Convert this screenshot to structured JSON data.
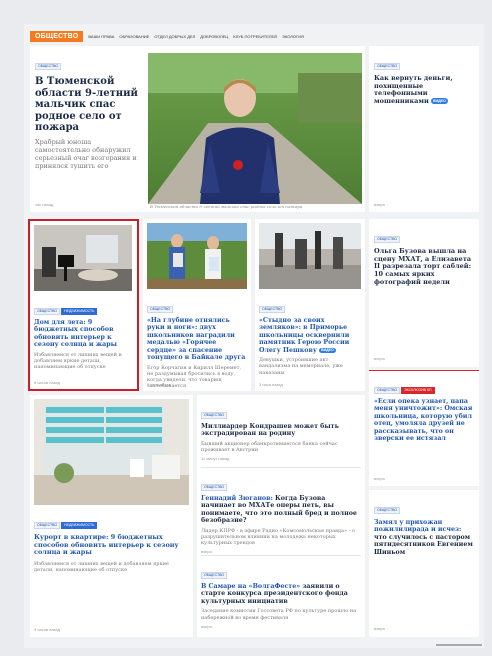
{
  "section_tag": "ОБЩЕСТВО",
  "nav": [
    "ВАШИ ПРАВА",
    "ОБРАЗОВАНИЕ",
    "ОТДЕЛ ДОБРЫХ ДЕЛ",
    "ДОБРОВОЛЕЦ",
    "КЛУБ ПОТРЕБИТЕЛЕЙ",
    "ЭКОЛОГИЯ"
  ],
  "hero": {
    "badge": "ОБЩЕСТВО",
    "title": "В Тюменской области 9-летний мальчик спас родное село от пожара",
    "lead": "Храбрый юноша самостоятельно обнаружил серьезный очаг возгорания и принялся тушить его",
    "meta": "час назад",
    "caption": "В Тюменской области 9-летний мальчик спас родное село от пожара."
  },
  "side1": {
    "badge": "ОБЩЕСТВО",
    "title": "Как вернуть деньги, похищенные телефонными мошенниками",
    "video": "ВИДЕО",
    "meta": "вчера"
  },
  "card_a": {
    "badges": [
      "ОБЩЕСТВО",
      "НЕДВИЖИМОСТЬ"
    ],
    "title": "Дом для лета: 9 бюджетных способов обновить интерьер к сезону солнца и жары",
    "lead": "Избавляемся от лишних вещей и добавляем яркие детали, напоминающие об отпуске",
    "meta": "9 часов назад"
  },
  "card_b": {
    "badge": "ОБЩЕСТВО",
    "title": "«На глубине отнялись руки и ноги»: двух школьников наградили медалью «Горячее сердце» за спасение тонущего в Байкале друга",
    "lead": "Егор Корчагин и Кирилл Шеремет, не раздумывая бросились в воду, когда увидели, что товарищ захлебывается",
    "meta": "2 часа назад"
  },
  "card_c": {
    "badge": "ОБЩЕСТВО",
    "title": "«Стыдно за своих земляков»: в Приморье школьницы осквернили памятник Герою России Олегу Пешкову",
    "video": "ВИДЕО",
    "lead": "Девушки, устроившие акт вандализма на мемориале, уже наказаны",
    "meta": "3 часа назад"
  },
  "side2": {
    "badge": "ОБЩЕСТВО",
    "title": "Ольга Бузова вышла на сцену МХАТ, а Елизавета II разрезала торт саблей: 10 самых ярких фотографий недели",
    "meta": "вчера"
  },
  "side3": {
    "badges": [
      "ОБЩЕСТВО",
      "ЭКСКЛЮЗИВ КП"
    ],
    "title": "«Если опека узнает, папа меня уничтожит»: Омская школьница, которую убил отец, умоляла друзей не рассказывать, что он зверски ее истязал",
    "meta": "вчера"
  },
  "card_d": {
    "badges": [
      "ОБЩЕСТВО",
      "НЕДВИЖИМОСТЬ"
    ],
    "title": "Курорт в квартире: 9 бюджетных способов обновить интерьер к сезону солнца и жары",
    "lead": "Избавляемся от лишних вещей и добавляем яркие детали, напоминающие об отпуске",
    "meta": "9 часов назад"
  },
  "list": [
    {
      "badge": "ОБЩЕСТВО",
      "title": "Миллиардер Кондрашев может быть экстрадирован на родину",
      "lead": "Бывший акционер обанкротившегося банка сейчас проживает в Австрии",
      "meta": "11 минут назад"
    },
    {
      "badge": "ОБЩЕСТВО",
      "title_link": "Геннадий Зюганов:",
      "title": " Когда Бузова начинает во МХАТе оперы петь, вы понимаете, что это полный бред и полное безобразие?",
      "lead": "Лидер КПРФ - в эфире Радио «Комсомольская правда» - о разрушительном влиянии на молодежь некоторых культурных трендов",
      "meta": "вчера"
    },
    {
      "badge": "ОБЩЕСТВО",
      "title_link": "В Самаре на «ВолгаФесте»",
      "title": " заявили о старте конкурса президентского фонда культурных инициатив",
      "lead": "Заседание комиссии Госсовета РФ по культуре прошло на набережной во время фестиваля",
      "meta": "вчера"
    }
  ],
  "side4": {
    "badge": "ОБЩЕСТВО",
    "title_link": "Замял у прихожан пожилилирада и исчез:",
    "title": " что случилось с пастором пятидесятников Евгением Шиньом",
    "meta": "вчера"
  },
  "colors": {
    "accent": "#f47b20",
    "link": "#1f56b0",
    "highlight_border": "#c8202a",
    "exclusive": "#d8262d"
  }
}
